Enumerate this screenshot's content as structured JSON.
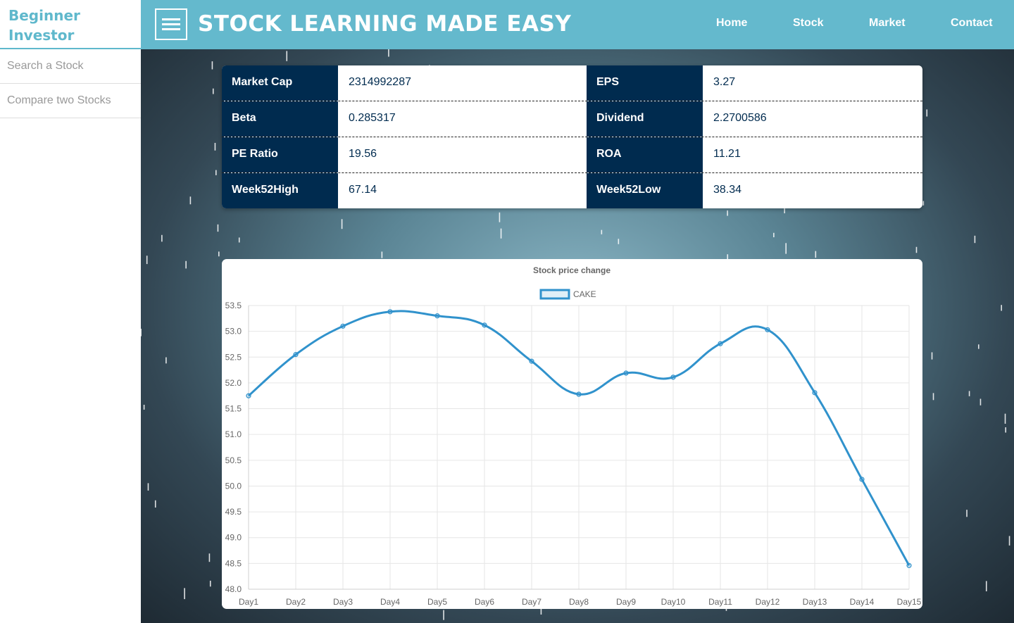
{
  "sidebar": {
    "brand_line1": "Beginner",
    "brand_line2": "Investor",
    "links": [
      {
        "label": "Search a Stock"
      },
      {
        "label": "Compare two Stocks"
      }
    ]
  },
  "header": {
    "title": "STOCK LEARNING MADE EASY",
    "nav": [
      {
        "label": "Home"
      },
      {
        "label": "Stock"
      },
      {
        "label": "Market"
      },
      {
        "label": "Contact"
      }
    ]
  },
  "stats": {
    "rows": [
      {
        "left_label": "Market Cap",
        "left_value": "2314992287",
        "right_label": "EPS",
        "right_value": "3.27"
      },
      {
        "left_label": "Beta",
        "left_value": "0.285317",
        "right_label": "Dividend",
        "right_value": "2.2700586"
      },
      {
        "left_label": "PE Ratio",
        "left_value": "19.56",
        "right_label": "ROA",
        "right_value": "11.21"
      },
      {
        "left_label": "Week52High",
        "left_value": "67.14",
        "right_label": "Week52Low",
        "right_value": "38.34"
      }
    ]
  },
  "colors": {
    "header": "#64b9cd",
    "stat_label_bg": "#002b4f",
    "series_line": "#3092cc"
  },
  "chart_data": {
    "type": "line",
    "title": "Stock price change",
    "categories": [
      "Day1",
      "Day2",
      "Day3",
      "Day4",
      "Day5",
      "Day6",
      "Day7",
      "Day8",
      "Day9",
      "Day10",
      "Day11",
      "Day12",
      "Day13",
      "Day14",
      "Day15"
    ],
    "series": [
      {
        "name": "CAKE",
        "values": [
          51.75,
          52.55,
          53.1,
          53.38,
          53.3,
          53.12,
          52.42,
          51.78,
          52.19,
          52.11,
          52.76,
          53.03,
          51.81,
          50.13,
          48.46
        ]
      }
    ],
    "yticks": [
      "53.5",
      "53.0",
      "52.5",
      "52.0",
      "51.5",
      "51.0",
      "50.5",
      "50.0",
      "49.5",
      "49.0",
      "48.5",
      "48.0"
    ],
    "ylim": [
      48.0,
      53.5
    ],
    "grid": true,
    "legend": "top"
  }
}
